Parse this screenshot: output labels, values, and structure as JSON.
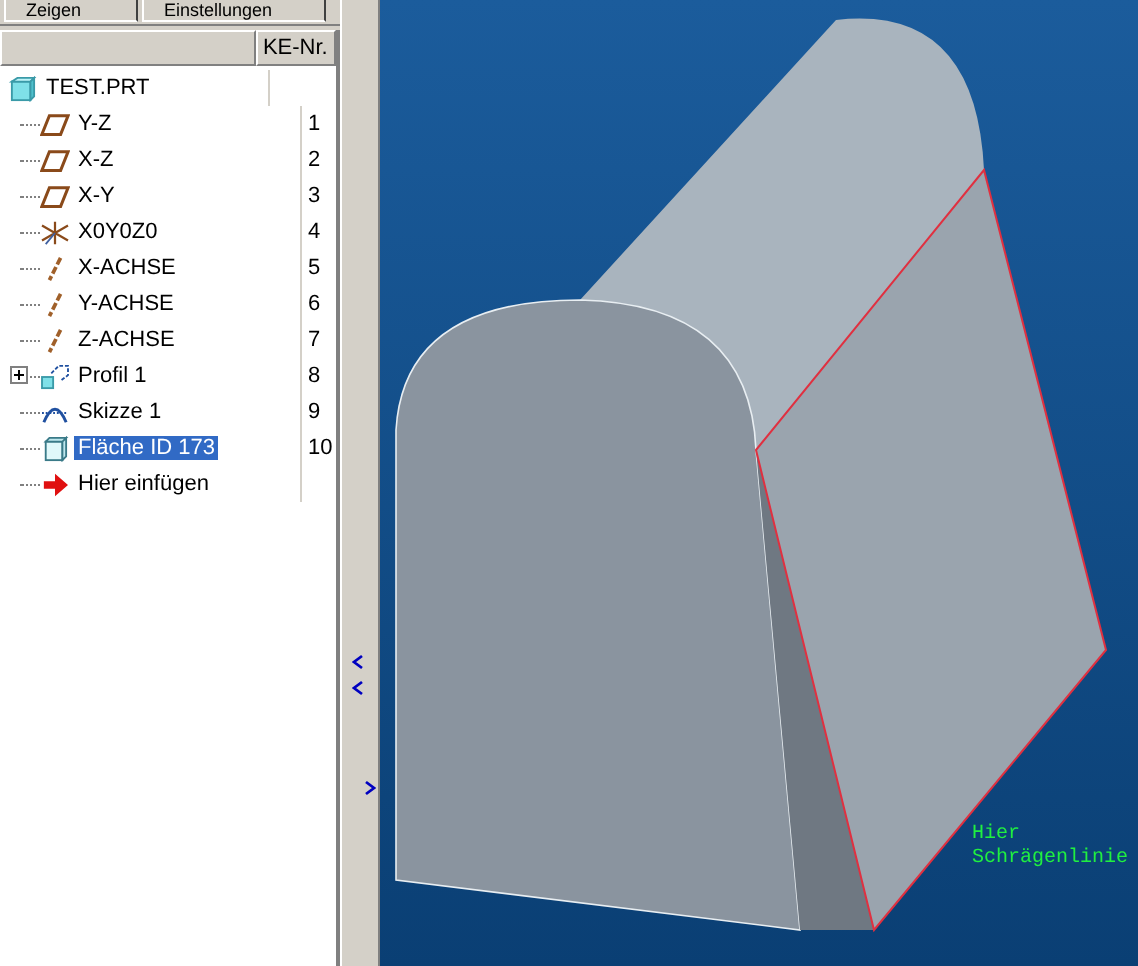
{
  "tabs": [
    {
      "label": "Zeigen",
      "selected": false
    },
    {
      "label": "Einstellungen",
      "selected": false
    }
  ],
  "tree_header": {
    "column_2": "KE-Nr."
  },
  "tree": {
    "label": "TEST.PRT",
    "kind": "part",
    "children": [
      {
        "label": "Y-Z",
        "kind": "plane",
        "number": "1",
        "selected": false,
        "expander": false
      },
      {
        "label": "X-Z",
        "kind": "plane",
        "number": "2",
        "selected": false,
        "expander": false
      },
      {
        "label": "X-Y",
        "kind": "plane",
        "number": "3",
        "selected": false,
        "expander": false
      },
      {
        "label": "X0Y0Z0",
        "kind": "origin",
        "number": "4",
        "selected": false,
        "expander": false
      },
      {
        "label": "X-ACHSE",
        "kind": "axis",
        "number": "5",
        "selected": false,
        "expander": false
      },
      {
        "label": "Y-ACHSE",
        "kind": "axis",
        "number": "6",
        "selected": false,
        "expander": false
      },
      {
        "label": "Z-ACHSE",
        "kind": "axis",
        "number": "7",
        "selected": false,
        "expander": false
      },
      {
        "label": "Profil 1",
        "kind": "profile",
        "number": "8",
        "selected": false,
        "expander": true
      },
      {
        "label": "Skizze 1",
        "kind": "sketch",
        "number": "9",
        "selected": false,
        "expander": false
      },
      {
        "label": "Fläche ID 173",
        "kind": "surface",
        "number": "10",
        "selected": true,
        "expander": false
      },
      {
        "label": "Hier einfügen",
        "kind": "insert",
        "selected": false,
        "expander": false
      }
    ]
  },
  "viewport": {
    "annotation_lines": [
      "Hier",
      "Schrägenlinie"
    ]
  }
}
